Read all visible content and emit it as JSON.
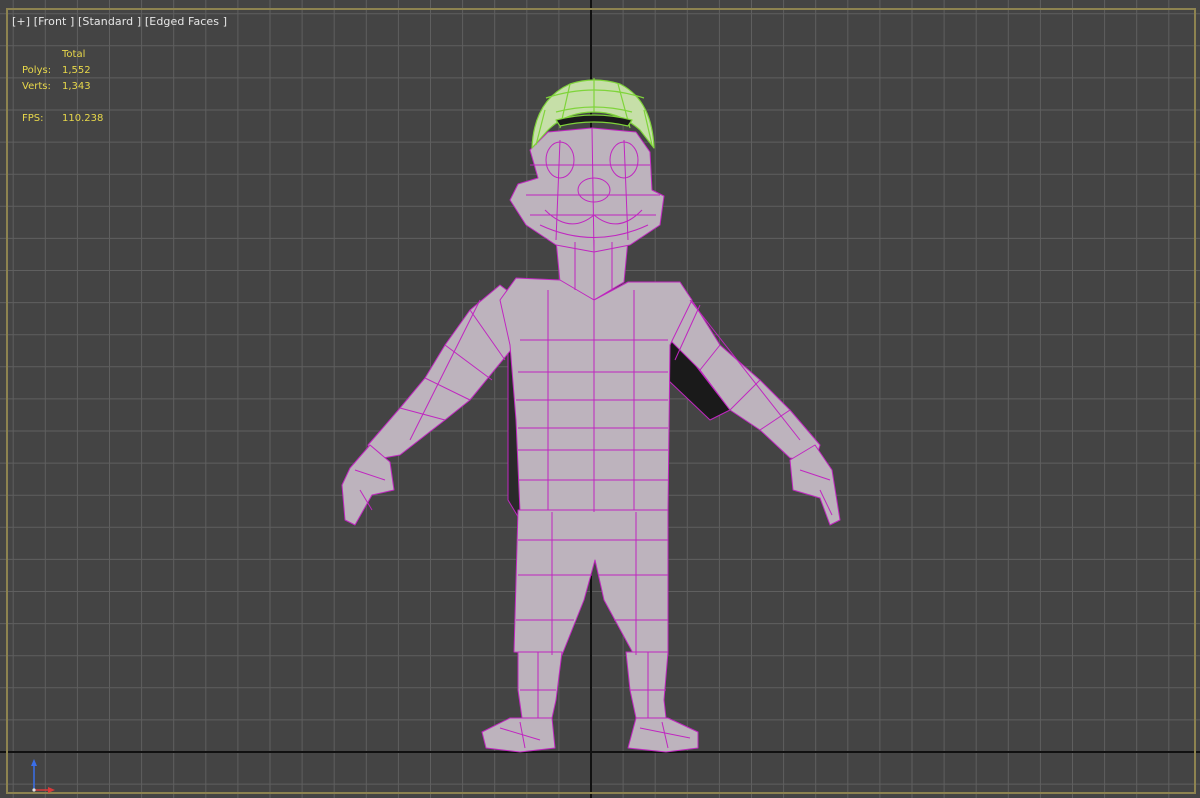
{
  "viewport": {
    "label_plus": "[+]",
    "label_view": "[Front ]",
    "label_shading": "[Standard ]",
    "label_edges": "[Edged Faces ]"
  },
  "stats": {
    "header": "Total",
    "polys_label": "Polys:",
    "polys_value": "1,552",
    "verts_label": "Verts:",
    "verts_value": "1,343",
    "fps_label": "FPS:",
    "fps_value": "110.238"
  },
  "colors": {
    "background": "#444444",
    "grid_minor": "#5f5f5f",
    "grid_major": "#111111",
    "border": "#8d8350",
    "mesh_fill": "#bdb3bd",
    "mesh_wire": "#c026c0",
    "helmet_fill": "#c6dfa8",
    "helmet_wire": "#7fd43a",
    "stats_text": "#e8d84a"
  },
  "model": {
    "name_icon": "character-mesh",
    "selected_part": "helmet"
  }
}
